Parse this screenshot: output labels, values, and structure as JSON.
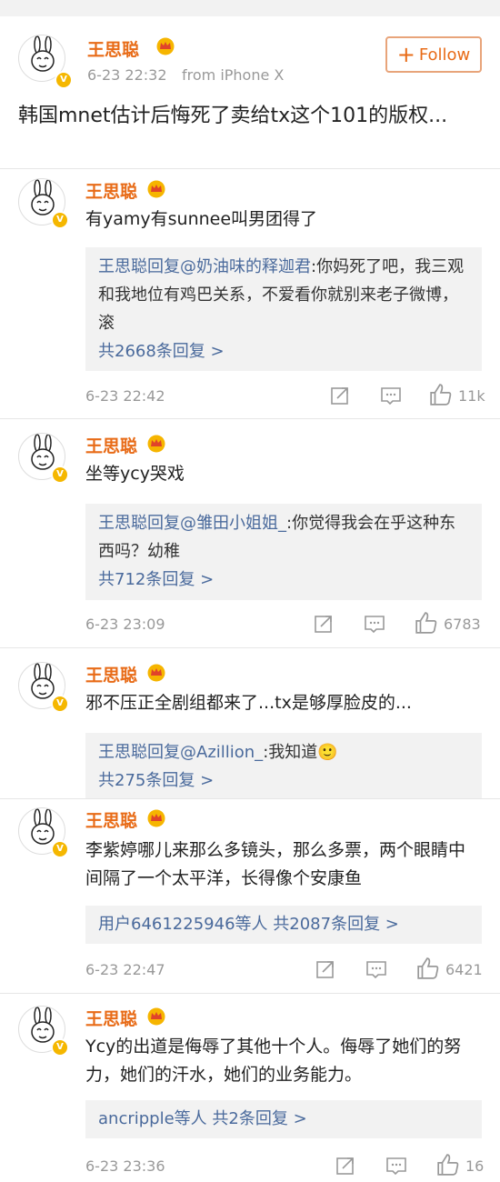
{
  "post": {
    "author": "王思聪",
    "time": "6-23 22:32",
    "source": "from iPhone X",
    "follow_label": "Follow",
    "text": "韩国mnet估计后悔死了卖给tx这个101的版权..."
  },
  "avatar_caption": "宝宝不哭",
  "comments": [
    {
      "author": "王思聪",
      "text": "有yamy有sunnee叫男团得了",
      "reply": {
        "prefix": "王思聪回复",
        "mention": "@奶油味的释迦君",
        "body": ":你妈死了吧，我三观和我地位有鸡巴关系，不爱看你就别来老子微博，滚"
      },
      "more": "共2668条回复 >",
      "time": "6-23 22:42",
      "likes": "11k"
    },
    {
      "author": "王思聪",
      "text": "坐等ycy哭戏",
      "reply": {
        "prefix": "王思聪回复",
        "mention": "@雏田小姐姐_",
        "body": ":你觉得我会在乎这种东西吗？幼稚"
      },
      "more": "共712条回复 >",
      "time": "6-23 23:09",
      "likes": "6783"
    },
    {
      "author": "王思聪",
      "text": "邪不压正全剧组都来了...tx是够厚脸皮的...",
      "reply": {
        "prefix": "王思聪回复",
        "mention": "@Azillion_",
        "body": ":我知道🙂"
      },
      "more": "共275条回复 >"
    },
    {
      "author": "王思聪",
      "text": "李紫婷哪儿来那么多镜头，那么多票，两个眼睛中间隔了一个太平洋，长得像个安康鱼",
      "reply_summary_users": "用户6461225946等人",
      "more": "共2087条回复 >",
      "time": "6-23 22:47",
      "likes": "6421"
    },
    {
      "author": "王思聪",
      "text": "Ycy的出道是侮辱了其他十个人。侮辱了她们的努力，她们的汗水，她们的业务能力。",
      "reply_summary_users": "ancripple等人",
      "more": "共2条回复 >",
      "time": "6-23 23:36",
      "likes": "16"
    }
  ],
  "colors": {
    "name": "#e86b17",
    "link": "#4a6a9c",
    "muted": "#999999",
    "reply_bg": "#f2f2f2"
  }
}
